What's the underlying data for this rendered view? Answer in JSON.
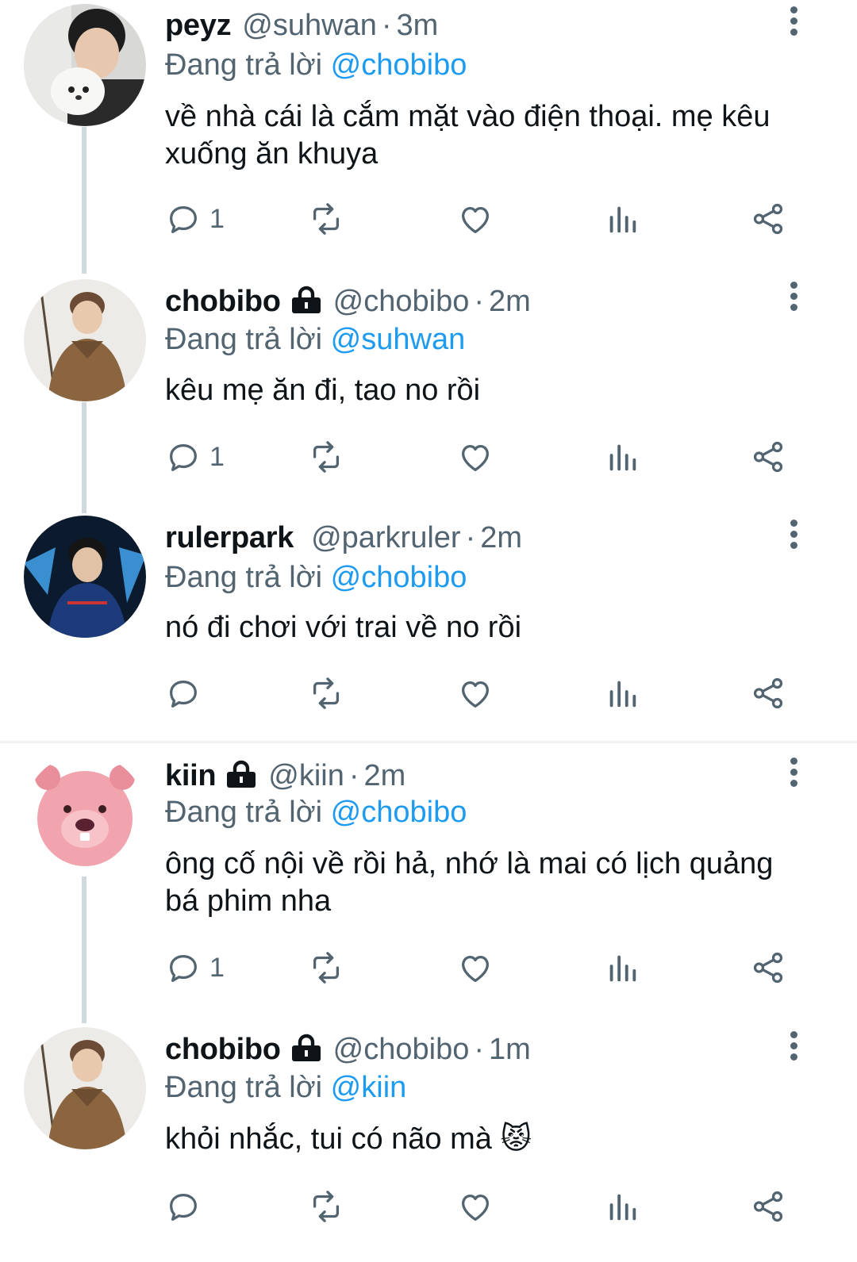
{
  "reply_prefix": "Đang trả lời",
  "tweets": [
    {
      "name": "peyz",
      "locked": false,
      "handle": "@suhwan",
      "time": "3m",
      "reply_to": "@chobibo",
      "text": "về nhà cái là cắm mặt vào điện thoại. mẹ kêu xuống ăn khuya",
      "replies": "1"
    },
    {
      "name": "chobibo",
      "locked": true,
      "handle": "@chobibo",
      "time": "2m",
      "reply_to": "@suhwan",
      "text": "kêu mẹ ăn đi, tao no rồi",
      "replies": "1"
    },
    {
      "name": "rulerpark",
      "locked": false,
      "handle": "@parkruler",
      "time": "2m",
      "reply_to": "@chobibo",
      "text": "nó đi chơi với trai về no rồi",
      "replies": ""
    },
    {
      "name": "kiin",
      "locked": true,
      "handle": "@kiin",
      "time": "2m",
      "reply_to": "@chobibo",
      "text": "ông cố nội về rồi hả, nhớ là mai có lịch quảng bá phim nha",
      "replies": "1"
    },
    {
      "name": "chobibo",
      "locked": true,
      "handle": "@chobibo",
      "time": "1m",
      "reply_to": "@kiin",
      "text": "khỏi nhắc, tui có não mà 😾",
      "replies": ""
    }
  ],
  "icons": {
    "reply": "reply-icon",
    "retweet": "retweet-icon",
    "like": "heart-icon",
    "views": "views-icon",
    "share": "share-icon",
    "more": "more-vertical-icon",
    "lock": "lock-icon"
  },
  "colors": {
    "mention": "#1d9bf0",
    "muted": "#536471",
    "thread_line": "#cfd9de"
  }
}
